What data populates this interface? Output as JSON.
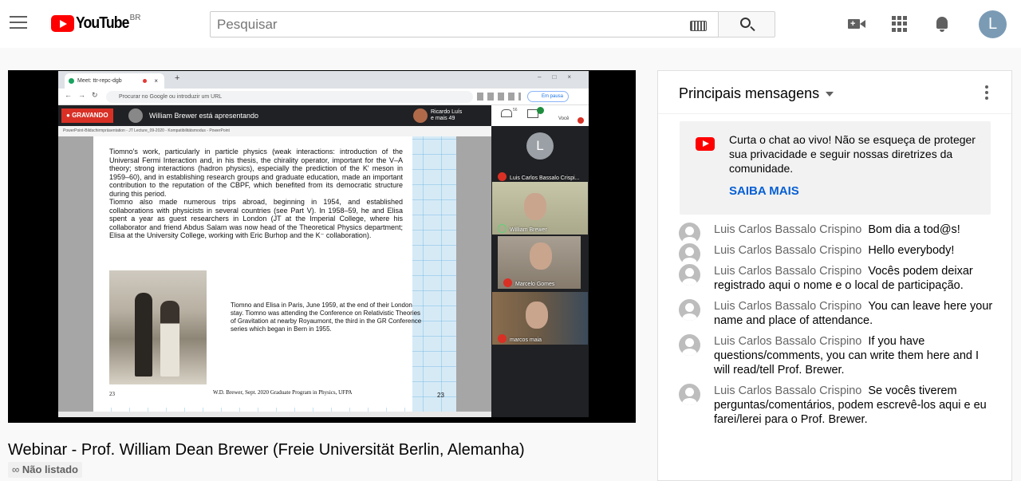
{
  "header": {
    "logo_text": "YouTube",
    "region": "BR",
    "search_placeholder": "Pesquisar",
    "avatar_letter": "L",
    "icons": [
      "menu-icon",
      "keyboard-icon",
      "search-icon",
      "create-video-icon",
      "apps-icon",
      "notifications-icon"
    ]
  },
  "player": {
    "browser_tab": "Meet: ttr-repc-dgb",
    "new_tab": "+",
    "omnibox": "Procurar no Google ou introduzir um URL",
    "pause_badge": "Em pausa",
    "recording": "GRAVANDO",
    "presenter": "William Brewer está apresentando",
    "others_line1": "Ricardo Luís",
    "others_line2": "e mais 49",
    "people_count": "56",
    "you_label": "Você",
    "ppt_title": "PowerPoint-Bildschirmpräsentation - JT Lecture_09-2020 - Kompatibilitätsmodus - PowerPoint",
    "slide": {
      "para1": "Tiomno's work, particularly in particle physics (weak interactions: introduction of the Universal Fermi Interaction and, in his thesis, the chirality operator, important for the V–A theory; strong interactions (hadron physics), especially the prediction of the K' meson in 1959–60), and in establishing research groups and graduate education, made an important contribution to the reputation of the CBPF, which benefited from its democratic structure during this period.",
      "para2": "Tiomno also made numerous trips abroad, beginning in 1954, and established collaborations with physicists in several countries (see Part V). In 1958–59, he and Elisa spent a year as guest researchers in London (JT at the Imperial College, where his collaborator and friend Abdus Salam was now head of the Theoretical Physics department; Elisa at the University College, working with Eric Burhop and the K⁻ collaboration).",
      "caption": "Tiomno and Elisa in Paris, June 1959, at the end of their London stay. Tiomno was attending the Conference on Relativistic Theories of Gravitation at nearby Royaumont, the third in the GR Conference series which began in Bern in 1955.",
      "page_number": "23",
      "footer": "W.D. Brewer, Sept. 2020  Graduate Program in Physics, UFPA",
      "page_number_right": "23"
    },
    "participants": [
      {
        "initial": "L",
        "name": "Luis Carlos Bassalo Crispi..."
      },
      {
        "name": "William Brewer"
      },
      {
        "name": "Marcelo Gomes"
      },
      {
        "name": "marcos maia"
      }
    ]
  },
  "video": {
    "title": "Webinar - Prof. William Dean Brewer (Freie Universität Berlin, Alemanha)",
    "visibility": "Não listado"
  },
  "chat": {
    "mode": "Principais mensagens",
    "notice_text": "Curta o chat ao vivo! Não se esqueça de proteger sua privacidade e seguir nossas diretrizes da comunidade.",
    "notice_link": "SAIBA MAIS",
    "messages": [
      {
        "author": "Luis Carlos Bassalo Crispino",
        "text": "Bom dia a tod@s!"
      },
      {
        "author": "Luis Carlos Bassalo Crispino",
        "text": "Hello everybody!"
      },
      {
        "author": "Luis Carlos Bassalo Crispino",
        "text": "Vocês podem deixar registrado aqui o nome e o local de participação."
      },
      {
        "author": "Luis Carlos Bassalo Crispino",
        "text": "You can leave here your name and place of attendance."
      },
      {
        "author": "Luis Carlos Bassalo Crispino",
        "text": "If you have questions/comments, you can write them here and I will read/tell Prof. Brewer."
      },
      {
        "author": "Luis Carlos Bassalo Crispino",
        "text": "Se vocês tiverem perguntas/comentários, podem escrevê-los aqui e eu farei/lerei para o Prof. Brewer."
      }
    ]
  }
}
